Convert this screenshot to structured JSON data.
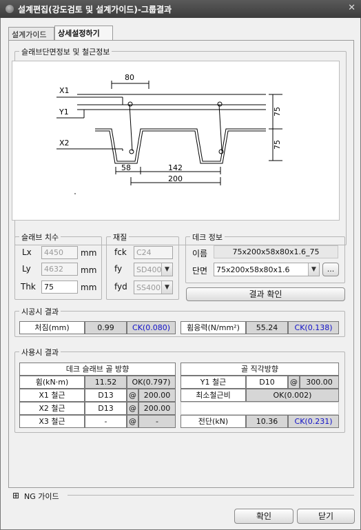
{
  "window": {
    "title": "설계편집(강도검토 및 설계가이드)-그룹결과",
    "close_glyph": "✕"
  },
  "tabs": [
    {
      "label": "설계가이드"
    },
    {
      "label": "상세설정하기"
    }
  ],
  "section_group": {
    "title": "슬래브단면정보 및 철근정보"
  },
  "drawing": {
    "labels": {
      "x1": "X1",
      "y1": "Y1",
      "x2": "X2"
    },
    "dims": {
      "d80": "80",
      "d75a": "75",
      "d75b": "75",
      "d58": "58",
      "d142": "142",
      "d200": "200"
    }
  },
  "slab": {
    "title": "슬래브 치수",
    "lx": {
      "label": "Lx",
      "value": "4450",
      "unit": "mm"
    },
    "ly": {
      "label": "Ly",
      "value": "4632",
      "unit": "mm"
    },
    "thk": {
      "label": "Thk",
      "value": "75",
      "unit": "mm"
    }
  },
  "material": {
    "title": "재질",
    "fck": {
      "label": "fck",
      "value": "C24"
    },
    "fy": {
      "label": "fy",
      "value": "SD400"
    },
    "fyd": {
      "label": "fyd",
      "value": "SS400"
    }
  },
  "deck": {
    "title": "데크 정보",
    "name_label": "이름",
    "name_value": "75x200x58x80x1.6_75",
    "section_label": "단면",
    "section_value": "75x200x58x80x1.6",
    "browse_label": "...",
    "confirm_result_label": "결과 확인"
  },
  "construction": {
    "title": "시공시 결과",
    "deflection_label": "처짐(mm)",
    "deflection_value": "0.99",
    "deflection_check": "CK(0.080)",
    "stress_label": "휨응력(N/mm²)",
    "stress_value": "55.24",
    "stress_check": "CK(0.138)"
  },
  "service": {
    "title": "사용시 결과",
    "left_header": "데크 슬래브 골 방향",
    "moment_label": "휨(kN·m)",
    "moment_value": "11.52",
    "moment_check": "OK(0.797)",
    "x1_label": "X1 철근",
    "x1_bar": "D13",
    "x1_at": "@",
    "x1_spacing": "200.00",
    "x2_label": "X2 철근",
    "x2_bar": "D13",
    "x2_at": "@",
    "x2_spacing": "200.00",
    "x3_label": "X3 철근",
    "x3_bar": "-",
    "x3_at": "@",
    "x3_spacing": "-",
    "right_header": "골 직각방향",
    "y1_label": "Y1 철근",
    "y1_bar": "D10",
    "y1_at": "@",
    "y1_spacing": "300.00",
    "min_ratio_label": "최소철근비",
    "min_ratio_value": "OK(0.002)",
    "shear_label": "전단(kN)",
    "shear_value": "10.36",
    "shear_check": "CK(0.231)"
  },
  "ng_guide": {
    "expander": "⊞",
    "label": "NG 가이드"
  },
  "footer": {
    "ok_label": "확인",
    "close_label": "닫기"
  }
}
